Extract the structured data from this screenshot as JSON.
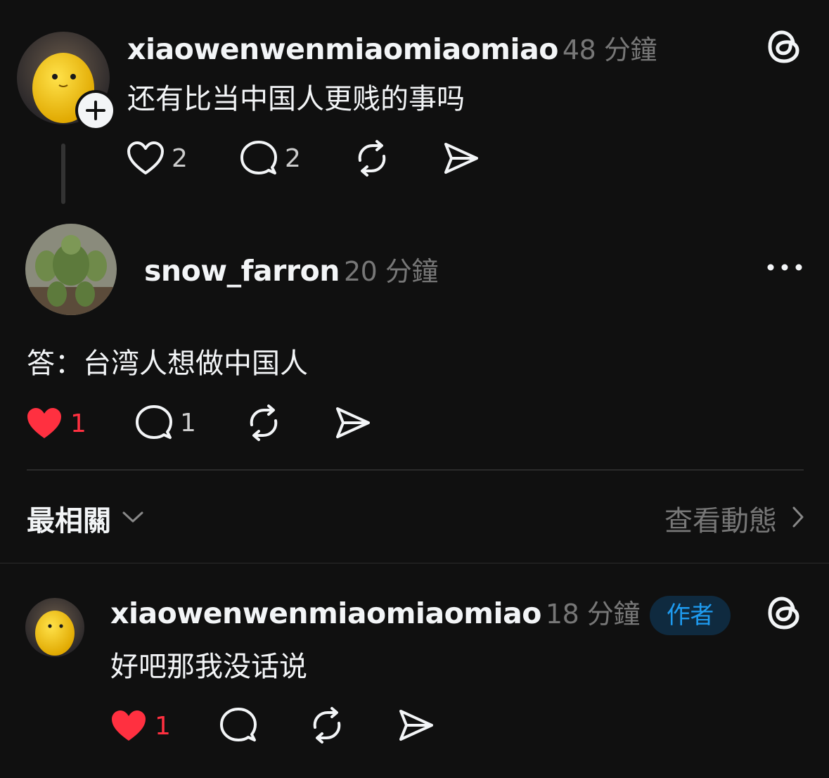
{
  "post": {
    "username": "xiaowenwenmiaomiaomiao",
    "time": "48 分鐘",
    "text": "还有比当中国人更贱的事吗",
    "likes": "2",
    "replies": "2",
    "follow_icon": "plus-icon",
    "app_icon": "threads-icon"
  },
  "reply": {
    "username": "snow_farron",
    "time": "20 分鐘",
    "text": "答：台湾人想做中国人",
    "likes": "1",
    "replies": "1",
    "liked": true,
    "more_icon": "more-icon"
  },
  "sort": {
    "label": "最相關",
    "activity_link": "查看動態"
  },
  "author_reply": {
    "username": "xiaowenwenmiaomiaomiao",
    "time": "18 分鐘",
    "badge": "作者",
    "text": "好吧那我没话说",
    "likes": "1",
    "liked": true,
    "app_icon": "threads-icon"
  },
  "colors": {
    "background": "#101010",
    "text": "#f3f5f7",
    "muted": "#777777",
    "like_red": "#ff3040",
    "author_badge_bg": "#0f2a3f",
    "author_badge_text": "#1e9bf0"
  }
}
